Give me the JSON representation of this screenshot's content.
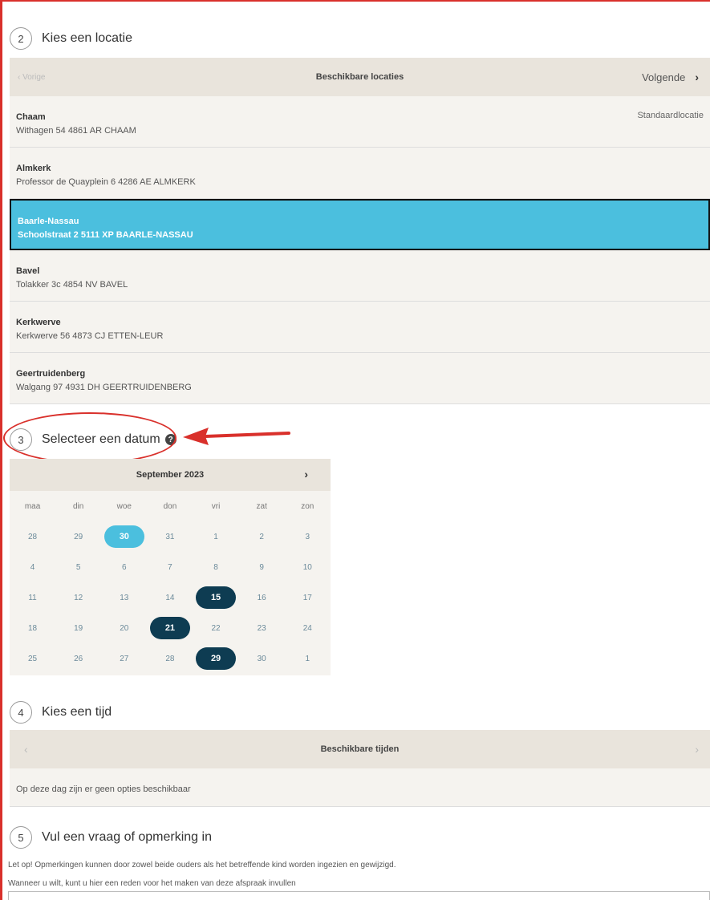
{
  "step2": {
    "number": "2",
    "title": "Kies een locatie",
    "bar": {
      "prev": "‹ Vorige",
      "center": "Beschikbare locaties",
      "next": "Volgende",
      "next_icon": "›"
    },
    "locations": [
      {
        "name": "Chaam",
        "address": "Withagen 54 4861 AR CHAAM",
        "tag": "Standaardlocatie"
      },
      {
        "name": "Almkerk",
        "address": "Professor de Quayplein 6 4286 AE ALMKERK",
        "tag": ""
      },
      {
        "name": "Baarle-Nassau",
        "address": "Schoolstraat 2 5111 XP BAARLE-NASSAU",
        "tag": ""
      },
      {
        "name": "Bavel",
        "address": "Tolakker 3c 4854 NV BAVEL",
        "tag": ""
      },
      {
        "name": "Kerkwerve",
        "address": "Kerkwerve 56 4873 CJ ETTEN-LEUR",
        "tag": ""
      },
      {
        "name": "Geertruidenberg",
        "address": "Walgang 97 4931 DH GEERTRUIDENBERG",
        "tag": ""
      }
    ],
    "selected_index": 2
  },
  "step3": {
    "number": "3",
    "title": "Selecteer een datum",
    "help_icon": "?",
    "calendar": {
      "month": "September 2023",
      "next_icon": "›",
      "weekdays": [
        "maa",
        "din",
        "woe",
        "don",
        "vri",
        "zat",
        "zon"
      ],
      "weeks": [
        [
          "28",
          "29",
          "30",
          "31",
          "1",
          "2",
          "3"
        ],
        [
          "4",
          "5",
          "6",
          "7",
          "8",
          "9",
          "10"
        ],
        [
          "11",
          "12",
          "13",
          "14",
          "15",
          "16",
          "17"
        ],
        [
          "18",
          "19",
          "20",
          "21",
          "22",
          "23",
          "24"
        ],
        [
          "25",
          "26",
          "27",
          "28",
          "29",
          "30",
          "1"
        ]
      ],
      "today": "30",
      "available": [
        "15",
        "21",
        "29"
      ]
    }
  },
  "step4": {
    "number": "4",
    "title": "Kies een tijd",
    "bar": {
      "prev": "‹",
      "center": "Beschikbare tijden",
      "next": "›"
    },
    "notice": "Op deze dag zijn er geen opties beschikbaar"
  },
  "step5": {
    "number": "5",
    "title": "Vul een vraag of opmerking in",
    "warning": "Let op! Opmerkingen kunnen door zowel beide ouders als het betreffende kind worden ingezien en gewijzigd.",
    "prompt": "Wanneer u wilt, kunt u hier een reden voor het maken van deze afspraak invullen",
    "textarea_value": ""
  },
  "colors": {
    "accent": "#4bbfde",
    "available": "#0e3c52",
    "annotation": "#d9302b"
  }
}
